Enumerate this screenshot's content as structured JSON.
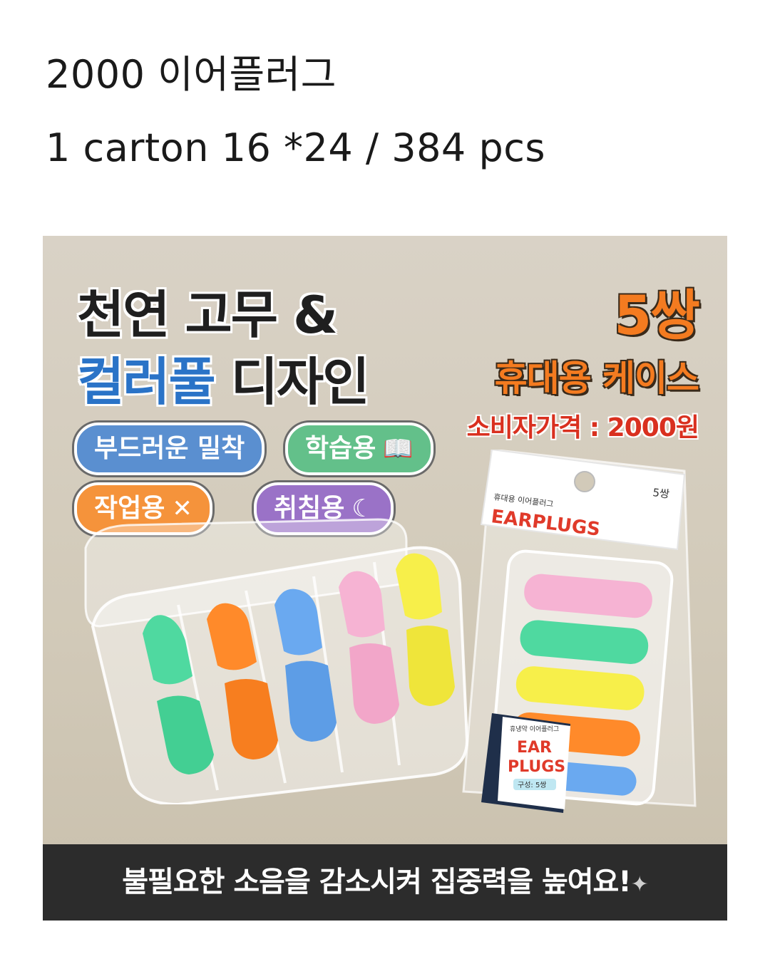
{
  "post": {
    "title_line": "2000 이어플러그",
    "detail_line": "1 carton 16 *24 / 384 pcs"
  },
  "product_image": {
    "headline_line1": "천연 고무 &",
    "headline_line2_colored": "컬러풀",
    "headline_line2_rest": " 디자인",
    "pairs": "5쌍",
    "case_label": "휴대용 케이스",
    "price": "소비자가격 : 2000원",
    "pills": {
      "soft_fit": "부드러운 밀착",
      "study": "학습용",
      "work": "작업용",
      "sleep": "취침용"
    },
    "package": {
      "brand": "EARPLUGS",
      "count": "5쌍",
      "product_name": "휴대용 이어플러그"
    },
    "case_sticker": {
      "maker": "휴냉약 이어플러그",
      "brand_top": "EAR",
      "brand_bottom": "PLUGS",
      "composition": "구성: 5쌍"
    },
    "bottom_caption": "불필요한 소음을 감소시켜 집중력을 높여요!",
    "colors": {
      "mint": "#4fd9a0",
      "orange": "#ff8a2a",
      "blue": "#6aa9f0",
      "pink": "#f6b3d3",
      "yellow": "#f7ef4a"
    }
  }
}
